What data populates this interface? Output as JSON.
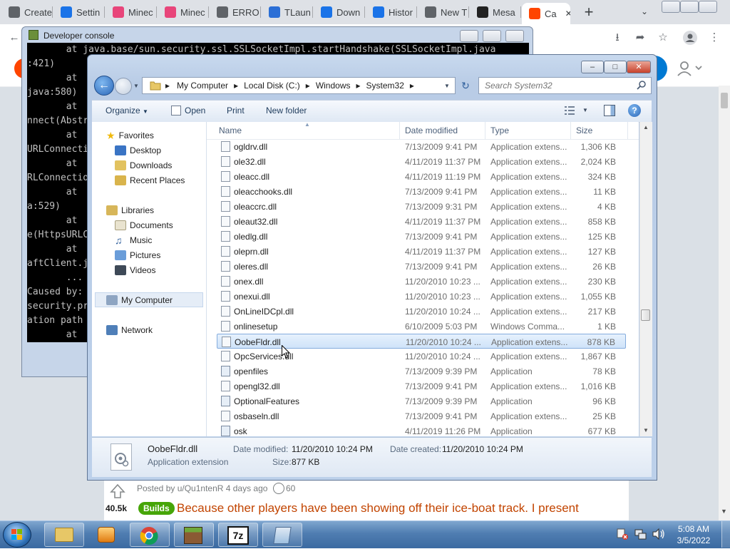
{
  "browser": {
    "tabs": [
      {
        "label": "Create",
        "color": "#5f6368"
      },
      {
        "label": "Settin",
        "color": "#1a73e8"
      },
      {
        "label": "Minec",
        "color": "#e8457a"
      },
      {
        "label": "Minec",
        "color": "#e8457a"
      },
      {
        "label": "ERRO",
        "color": "#5f6368"
      },
      {
        "label": "TLaun",
        "color": "#2b6fd6"
      },
      {
        "label": "Down",
        "color": "#1a73e8"
      },
      {
        "label": "Histor",
        "color": "#1a73e8"
      },
      {
        "label": "New T",
        "color": "#5f6368"
      },
      {
        "label": "Mesa",
        "color": "#222222"
      },
      {
        "label": "Ca",
        "color": "#ff4500"
      }
    ],
    "new_tab": "+",
    "tab_search": "⌄"
  },
  "console": {
    "title": "Developer console",
    "lines": [
      "       at java.base/sun.security.ssl.SSLSocketImpl.startHandshake(SSLSocketImpl.java",
      ":421)",
      "       at",
      "java:580)",
      "       at",
      "nnect(Abstr",
      "       at",
      "URLConnecti",
      "       at",
      "RLConnectio",
      "       at",
      "a:529)",
      "       at",
      "e(HttpsURLC",
      "       at",
      "aftClient.j",
      "       ...",
      "Caused by:",
      "security.pr",
      "ation path",
      "       at"
    ]
  },
  "reddit": {
    "posted_by": "Posted by u/Qu1ntenR 4 days ago",
    "award_count": "60",
    "votes": "40.5k",
    "flair": "Builds",
    "post_title": "Because other players have been showing off their ice-boat track. I present"
  },
  "explorer": {
    "breadcrumb": [
      "My Computer",
      "Local Disk (C:)",
      "Windows",
      "System32"
    ],
    "search_placeholder": "Search System32",
    "commands": {
      "organize": "Organize",
      "open": "Open",
      "print": "Print",
      "new_folder": "New folder"
    },
    "nav": {
      "favorites": "Favorites",
      "desktop": "Desktop",
      "downloads": "Downloads",
      "recent": "Recent Places",
      "libraries": "Libraries",
      "documents": "Documents",
      "music": "Music",
      "pictures": "Pictures",
      "videos": "Videos",
      "computer": "My Computer",
      "network": "Network"
    },
    "columns": {
      "name": "Name",
      "date": "Date modified",
      "type": "Type",
      "size": "Size"
    },
    "files": [
      {
        "name": "ogldrv.dll",
        "date": "7/13/2009 9:41 PM",
        "type": "Application extens...",
        "size": "1,306 KB",
        "kind": "dll"
      },
      {
        "name": "ole32.dll",
        "date": "4/11/2019 11:37 PM",
        "type": "Application extens...",
        "size": "2,024 KB",
        "kind": "dll"
      },
      {
        "name": "oleacc.dll",
        "date": "4/11/2019 11:19 PM",
        "type": "Application extens...",
        "size": "324 KB",
        "kind": "dll"
      },
      {
        "name": "oleacchooks.dll",
        "date": "7/13/2009 9:41 PM",
        "type": "Application extens...",
        "size": "11 KB",
        "kind": "dll"
      },
      {
        "name": "oleaccrc.dll",
        "date": "7/13/2009 9:31 PM",
        "type": "Application extens...",
        "size": "4 KB",
        "kind": "dll"
      },
      {
        "name": "oleaut32.dll",
        "date": "4/11/2019 11:37 PM",
        "type": "Application extens...",
        "size": "858 KB",
        "kind": "dll"
      },
      {
        "name": "oledlg.dll",
        "date": "7/13/2009 9:41 PM",
        "type": "Application extens...",
        "size": "125 KB",
        "kind": "dll"
      },
      {
        "name": "oleprn.dll",
        "date": "4/11/2019 11:37 PM",
        "type": "Application extens...",
        "size": "127 KB",
        "kind": "dll"
      },
      {
        "name": "oleres.dll",
        "date": "7/13/2009 9:41 PM",
        "type": "Application extens...",
        "size": "26 KB",
        "kind": "dll"
      },
      {
        "name": "onex.dll",
        "date": "11/20/2010 10:23 ...",
        "type": "Application extens...",
        "size": "230 KB",
        "kind": "dll"
      },
      {
        "name": "onexui.dll",
        "date": "11/20/2010 10:23 ...",
        "type": "Application extens...",
        "size": "1,055 KB",
        "kind": "dll"
      },
      {
        "name": "OnLineIDCpl.dll",
        "date": "11/20/2010 10:24 ...",
        "type": "Application extens...",
        "size": "217 KB",
        "kind": "dll"
      },
      {
        "name": "onlinesetup",
        "date": "6/10/2009 5:03 PM",
        "type": "Windows Comma...",
        "size": "1 KB",
        "kind": "cmd"
      },
      {
        "name": "OobeFldr.dll",
        "date": "11/20/2010 10:24 ...",
        "type": "Application extens...",
        "size": "878 KB",
        "kind": "dll",
        "selected": true
      },
      {
        "name": "OpcServices.dll",
        "date": "11/20/2010 10:24 ...",
        "type": "Application extens...",
        "size": "1,867 KB",
        "kind": "dll"
      },
      {
        "name": "openfiles",
        "date": "7/13/2009 9:39 PM",
        "type": "Application",
        "size": "78 KB",
        "kind": "app"
      },
      {
        "name": "opengl32.dll",
        "date": "7/13/2009 9:41 PM",
        "type": "Application extens...",
        "size": "1,016 KB",
        "kind": "dll"
      },
      {
        "name": "OptionalFeatures",
        "date": "7/13/2009 9:39 PM",
        "type": "Application",
        "size": "96 KB",
        "kind": "app"
      },
      {
        "name": "osbaseln.dll",
        "date": "7/13/2009 9:41 PM",
        "type": "Application extens...",
        "size": "25 KB",
        "kind": "dll"
      },
      {
        "name": "osk",
        "date": "4/11/2019 11:26 PM",
        "type": "Application",
        "size": "677 KB",
        "kind": "app"
      }
    ],
    "details": {
      "name": "OobeFldr.dll",
      "type": "Application extension",
      "modified_label": "Date modified:",
      "modified_value": "11/20/2010 10:24 PM",
      "created_label": "Date created:",
      "created_value": "11/20/2010 10:24 PM",
      "size_label": "Size:",
      "size_value": "877 KB"
    }
  },
  "taskbar": {
    "time": "5:08 AM",
    "date": "3/5/2022"
  }
}
